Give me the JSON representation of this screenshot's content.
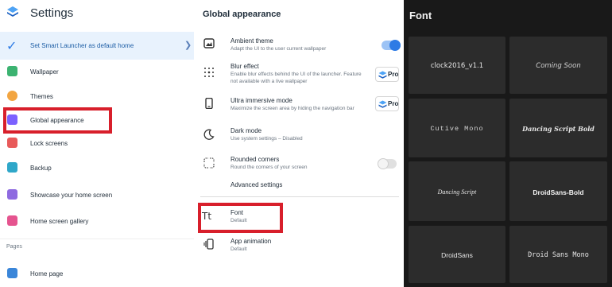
{
  "colors": {
    "accent": "#2d7be5",
    "highlight_box": "#d81f2b",
    "font_bg": "#191919",
    "font_tile": "#2c2c2c"
  },
  "settings": {
    "title": "Settings",
    "promo": {
      "label": "Set Smart Launcher as default home",
      "icon": "check-icon"
    },
    "items": [
      {
        "label": "Wallpaper",
        "icon": "wallpaper-icon",
        "color": "#3cb371"
      },
      {
        "label": "Themes",
        "icon": "themes-icon",
        "color": "#f2a541"
      },
      {
        "label": "Global appearance",
        "icon": "global-appearance-icon",
        "color": "#7b61ff"
      },
      {
        "label": "Lock screens",
        "icon": "lock-icon",
        "color": "#e85a5a"
      },
      {
        "label": "Backup",
        "icon": "backup-icon",
        "color": "#2fa7c9"
      },
      {
        "label": "Showcase your home screen",
        "icon": "showcase-icon",
        "color": "#8e6ae0"
      },
      {
        "label": "Home screen gallery",
        "icon": "gallery-icon",
        "color": "#e5548f"
      }
    ],
    "section_pages": "Pages",
    "page_items": [
      {
        "label": "Home page",
        "icon": "home-icon",
        "color": "#3a86d9"
      }
    ]
  },
  "global": {
    "title": "Global appearance",
    "items": [
      {
        "title": "Ambient theme",
        "desc": "Adapt the UI to the user current wallpaper",
        "icon": "ambient-theme-icon",
        "toggle": "on"
      },
      {
        "title": "Blur effect",
        "desc": "Enable blur effects behind the UI of the launcher. Feature not available with a live wallpaper",
        "icon": "blur-icon",
        "badge": "Pro"
      },
      {
        "title": "Ultra immersive mode",
        "desc": "Maximize the screen area by hiding the navigation bar",
        "icon": "phone-icon",
        "badge": "Pro"
      },
      {
        "title": "Dark mode",
        "desc": "Use system settings – Disabled",
        "icon": "moon-icon"
      },
      {
        "title": "Rounded corners",
        "desc": "Round the corners of your screen",
        "icon": "rounded-corners-icon",
        "toggle": "off"
      }
    ],
    "advanced": "Advanced settings",
    "font": {
      "title": "Font",
      "desc": "Default",
      "icon": "text-size-icon"
    },
    "animation": {
      "title": "App animation",
      "desc": "Default",
      "icon": "animation-icon"
    }
  },
  "font_picker": {
    "title": "Font",
    "fonts": [
      "clock2016_v1.1",
      "Coming Soon",
      "Cutive Mono",
      "Dancing Script Bold",
      "Dancing Script",
      "DroidSans-Bold",
      "DroidSans",
      "Droid Sans Mono"
    ]
  }
}
